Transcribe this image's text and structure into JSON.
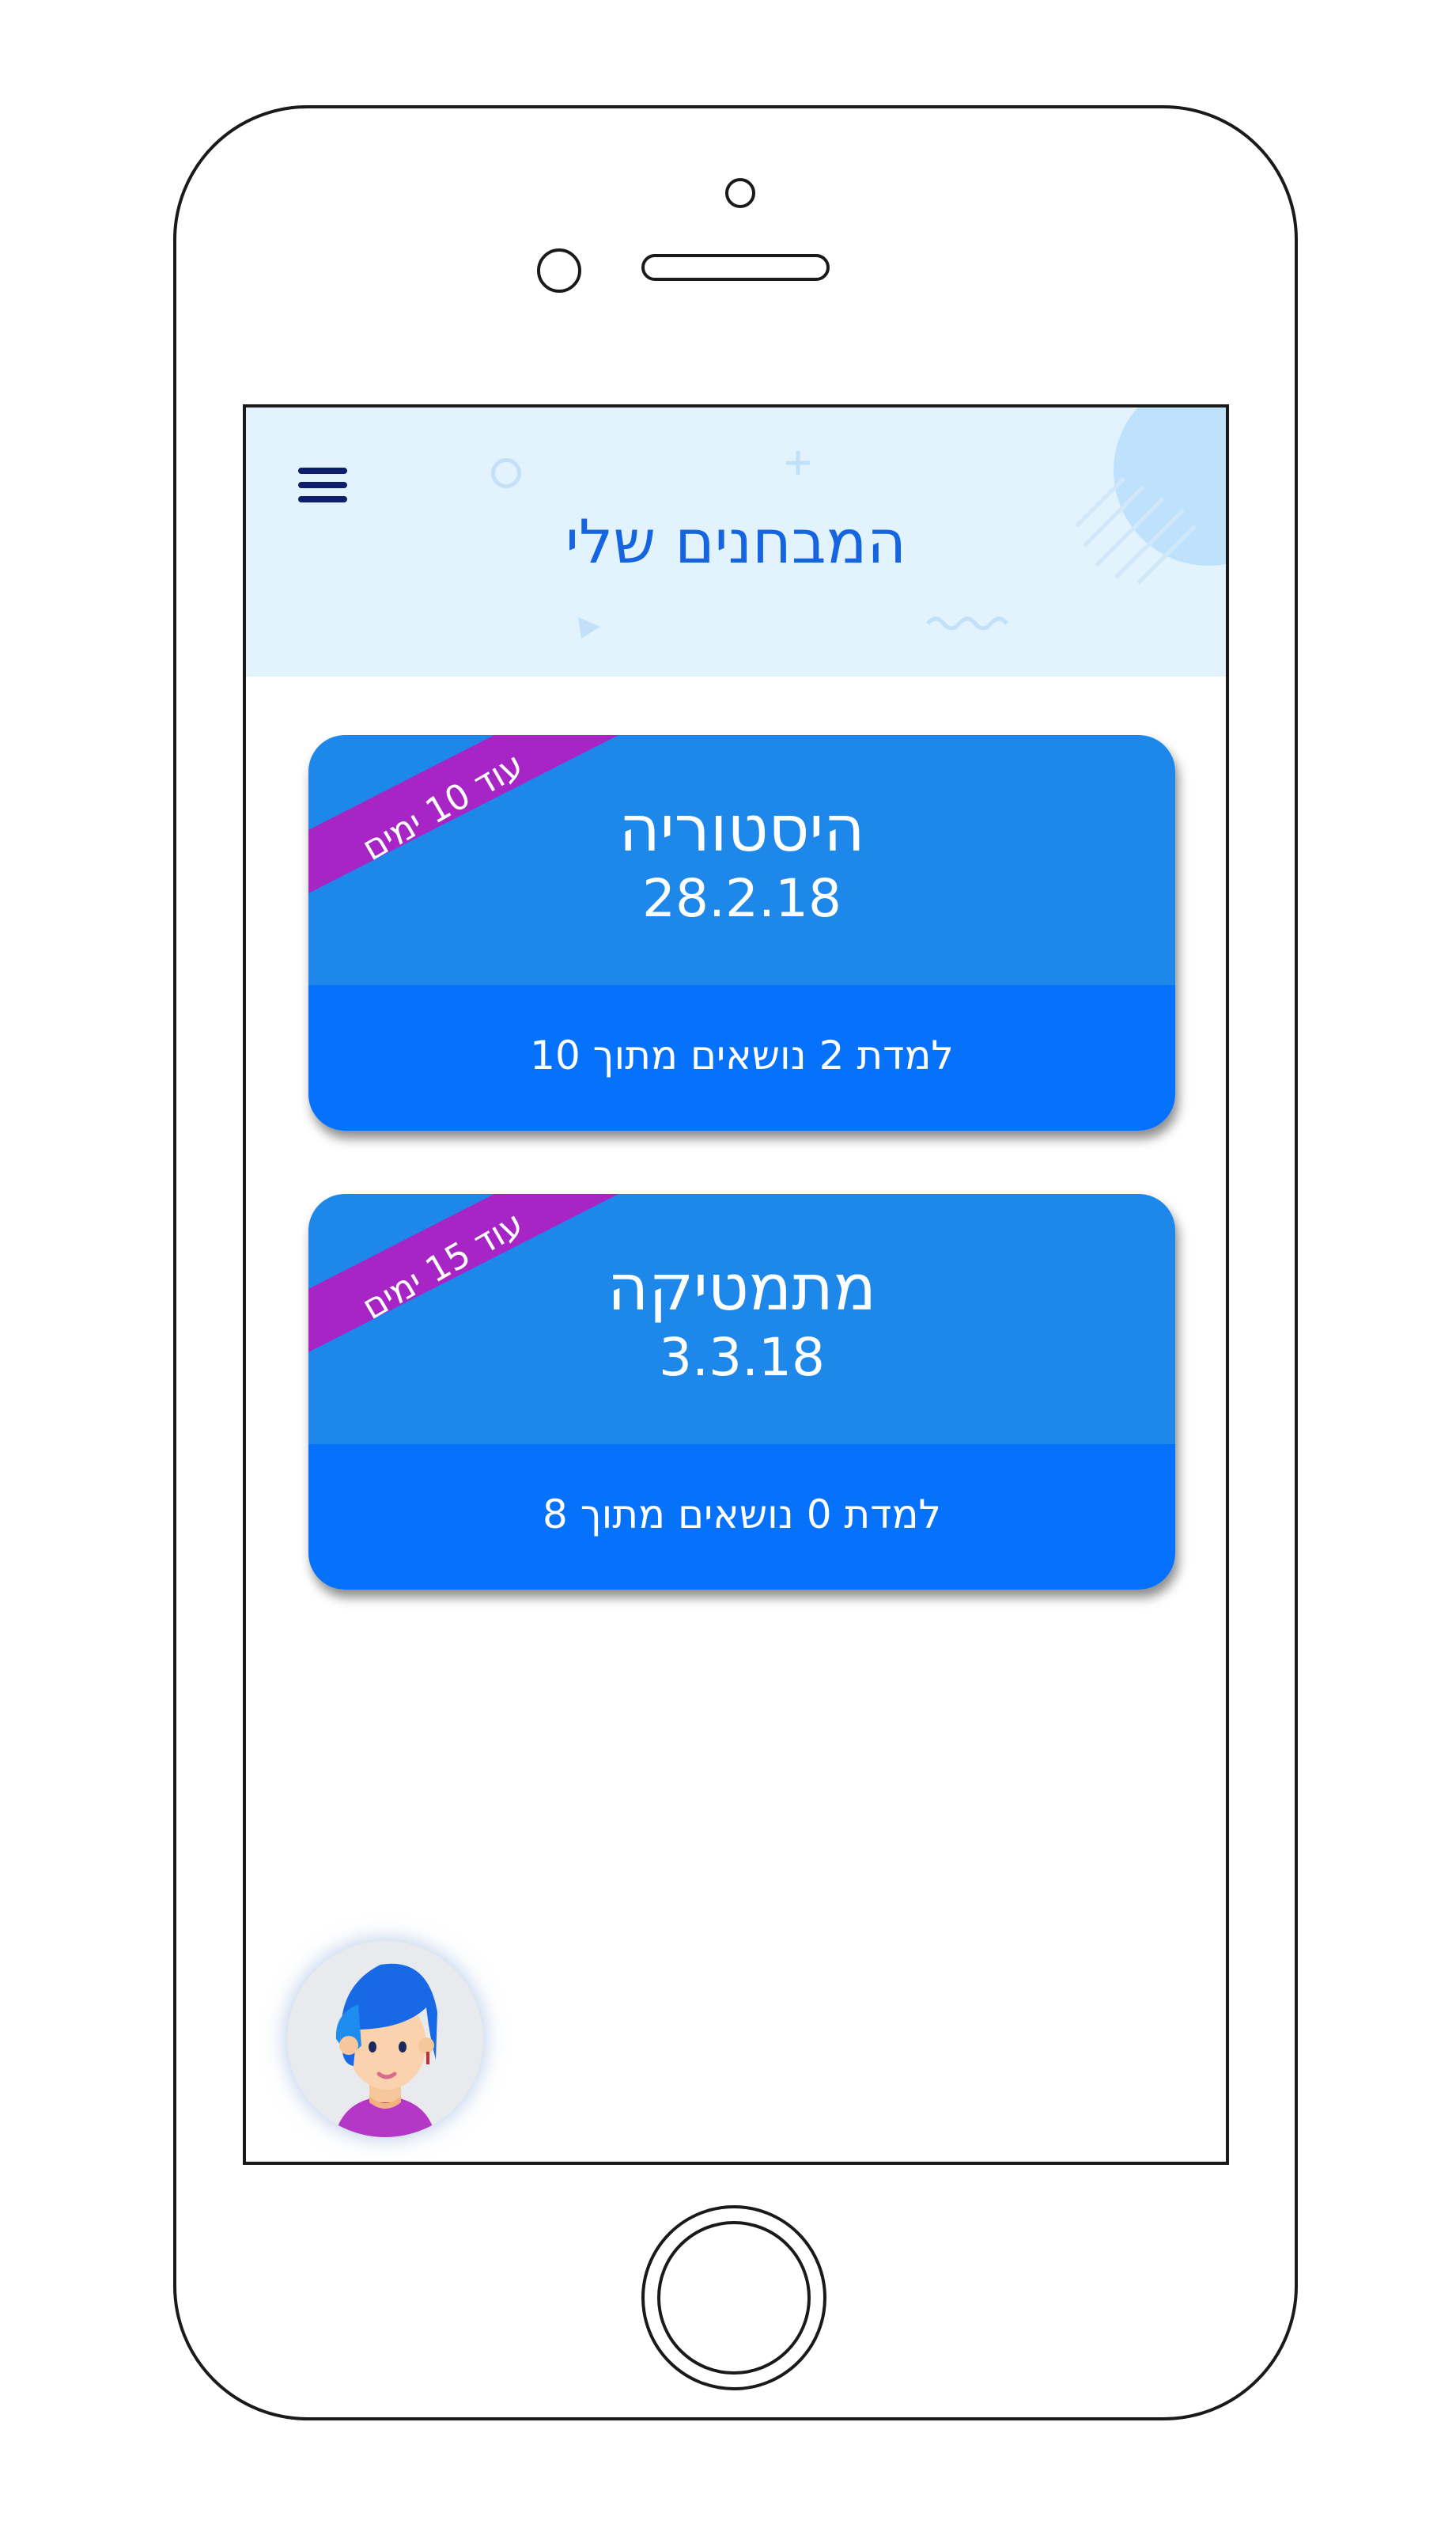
{
  "header": {
    "title": "המבחנים שלי",
    "menu_icon": "hamburger-menu-icon"
  },
  "colors": {
    "header_bg": "#e3f3fd",
    "title": "#1565e0",
    "card_top": "#1e87ea",
    "card_bottom": "#0672fc",
    "ribbon": "#a725c4"
  },
  "exams": [
    {
      "subject": "היסטוריה",
      "date": "28.2.18",
      "ribbon": "עוד 10 ימים",
      "progress": "למדת 2 נושאים מתוך 10"
    },
    {
      "subject": "מתמטיקה",
      "date": "3.3.18",
      "ribbon": "עוד 15 ימים",
      "progress": "למדת 0 נושאים מתוך 8"
    }
  ],
  "avatar": {
    "icon": "user-avatar-icon"
  }
}
